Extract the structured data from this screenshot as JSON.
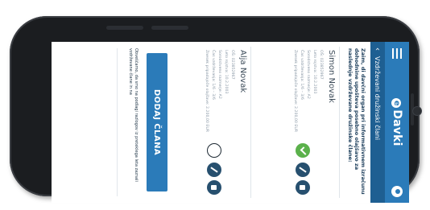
{
  "app": {
    "brand": "Davki",
    "brand_mark": "e",
    "screen_title": "Vzdrževani družinski člani",
    "back_glyph": "‹"
  },
  "intro_text": "Zaim, di davčni organ pri informativnem izračunu dohodnine upošteva posebno olajšavo za naslednje vzdrževane družinske člane:",
  "members": [
    {
      "name": "Simon Novak",
      "lines": [
        "OŠ: 023852967",
        "Leto rojstva: 10.2.2003",
        "Sorodstveno razmerje: A2",
        "Čas vzdrževanja: 1/6 – 3/6",
        "Znesek pripadajoče olajšave: 2.200,00 EUR"
      ],
      "status": "checked"
    },
    {
      "name": "Alja Novak",
      "lines": [
        "OŠ: 023852967",
        "Leto rojstva: 10.2.2003",
        "Sorodstveno razmerje: A2",
        "Čas vzdrževanja: 1/6 – 3/6",
        "Znesek pripadajoče olajšave: 2.200,00 EUR"
      ],
      "status": "unchecked"
    }
  ],
  "add_button_label": "DODAJ ČLANA",
  "footnote": "Obveščamo, da smo na podlagi razlogov iz preteklega leta zaznali vzdrževane člane in na"
}
